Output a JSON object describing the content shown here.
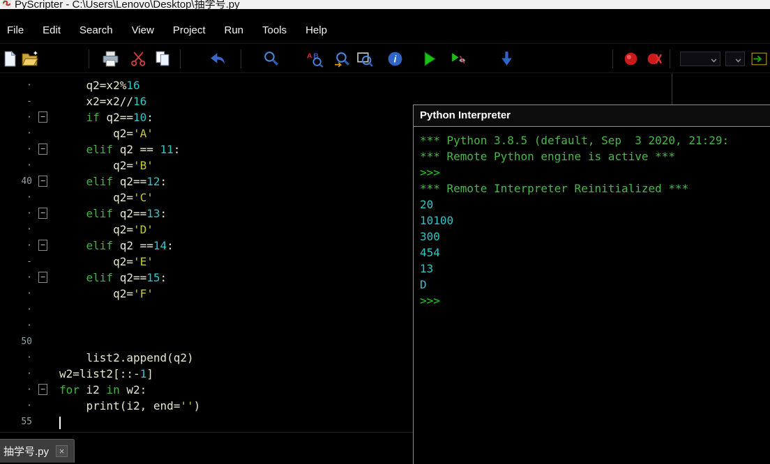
{
  "window": {
    "title": "PyScripter - C:\\Users\\Lenovo\\Desktop\\抽学号.py"
  },
  "menu": {
    "items": [
      "File",
      "Edit",
      "Search",
      "View",
      "Project",
      "Run",
      "Tools",
      "Help"
    ]
  },
  "toolbar": {
    "icon_names": [
      "new-file-icon",
      "open-file-icon",
      "print-icon",
      "cut-icon",
      "copy-icon",
      "undo-icon",
      "search-icon",
      "find-replace-icon",
      "find-next-icon",
      "find-in-files-icon",
      "info-icon",
      "run-icon",
      "debug-icon",
      "step-down-icon",
      "breakpoint-icon",
      "clear-breakpoints-icon",
      "run-config-dropdown",
      "secondary-dropdown",
      "layout-icon"
    ]
  },
  "colors": {
    "keyword": "#3cba3c",
    "number": "#2fc6c6",
    "string": "#c9c938",
    "identifier": "#e7e7cf",
    "interpreter_message": "#49b849",
    "interpreter_prompt": "#12d212",
    "interpreter_output": "#2fc6c6",
    "run_green": "#18c018",
    "stop_red": "#cc1a1a"
  },
  "editor": {
    "visible_line_numbers": [
      "40",
      "50",
      "55"
    ],
    "lines": [
      {
        "gutter": "·",
        "fold": false,
        "tokens": [
          [
            "id",
            "    q2=x2%"
          ],
          [
            "num",
            "16"
          ]
        ]
      },
      {
        "gutter": "-",
        "fold": false,
        "tokens": [
          [
            "id",
            "    x2=x2//"
          ],
          [
            "num",
            "16"
          ]
        ]
      },
      {
        "gutter": "·",
        "fold": true,
        "tokens": [
          [
            "id",
            "    "
          ],
          [
            "kw",
            "if"
          ],
          [
            "id",
            " q2=="
          ],
          [
            "num",
            "10"
          ],
          [
            "id",
            ":"
          ]
        ]
      },
      {
        "gutter": "·",
        "fold": false,
        "tokens": [
          [
            "id",
            "        q2="
          ],
          [
            "str",
            "'A'"
          ]
        ]
      },
      {
        "gutter": "·",
        "fold": true,
        "tokens": [
          [
            "id",
            "    "
          ],
          [
            "kw",
            "elif"
          ],
          [
            "id",
            " q2 == "
          ],
          [
            "num",
            "11"
          ],
          [
            "id",
            ":"
          ]
        ]
      },
      {
        "gutter": "·",
        "fold": false,
        "tokens": [
          [
            "id",
            "        q2="
          ],
          [
            "str",
            "'B'"
          ]
        ]
      },
      {
        "gutter": "40",
        "fold": true,
        "tokens": [
          [
            "id",
            "    "
          ],
          [
            "kw",
            "elif"
          ],
          [
            "id",
            " q2=="
          ],
          [
            "num",
            "12"
          ],
          [
            "id",
            ":"
          ]
        ]
      },
      {
        "gutter": "·",
        "fold": false,
        "tokens": [
          [
            "id",
            "        q2="
          ],
          [
            "str",
            "'C'"
          ]
        ]
      },
      {
        "gutter": "·",
        "fold": true,
        "tokens": [
          [
            "id",
            "    "
          ],
          [
            "kw",
            "elif"
          ],
          [
            "id",
            " q2=="
          ],
          [
            "num",
            "13"
          ],
          [
            "id",
            ":"
          ]
        ]
      },
      {
        "gutter": "·",
        "fold": false,
        "tokens": [
          [
            "id",
            "        q2="
          ],
          [
            "str",
            "'D'"
          ]
        ]
      },
      {
        "gutter": "·",
        "fold": true,
        "tokens": [
          [
            "id",
            "    "
          ],
          [
            "kw",
            "elif"
          ],
          [
            "id",
            " q2 =="
          ],
          [
            "num",
            "14"
          ],
          [
            "id",
            ":"
          ]
        ]
      },
      {
        "gutter": "-",
        "fold": false,
        "tokens": [
          [
            "id",
            "        q2="
          ],
          [
            "str",
            "'E'"
          ]
        ]
      },
      {
        "gutter": "·",
        "fold": true,
        "tokens": [
          [
            "id",
            "    "
          ],
          [
            "kw",
            "elif"
          ],
          [
            "id",
            " q2=="
          ],
          [
            "num",
            "15"
          ],
          [
            "id",
            ":"
          ]
        ]
      },
      {
        "gutter": "·",
        "fold": false,
        "tokens": [
          [
            "id",
            "        q2="
          ],
          [
            "str",
            "'F'"
          ]
        ]
      },
      {
        "gutter": "·",
        "fold": false,
        "tokens": []
      },
      {
        "gutter": "·",
        "fold": false,
        "tokens": []
      },
      {
        "gutter": "50",
        "fold": false,
        "tokens": []
      },
      {
        "gutter": "·",
        "fold": false,
        "tokens": [
          [
            "id",
            "    list2.append(q2)"
          ]
        ]
      },
      {
        "gutter": "·",
        "fold": false,
        "tokens": [
          [
            "id",
            "w2=list2[::-"
          ],
          [
            "num",
            "1"
          ],
          [
            "id",
            "]"
          ]
        ]
      },
      {
        "gutter": "·",
        "fold": true,
        "tokens": [
          [
            "kw",
            "for"
          ],
          [
            "id",
            " i2 "
          ],
          [
            "kw",
            "in"
          ],
          [
            "id",
            " w2:"
          ]
        ]
      },
      {
        "gutter": "·",
        "fold": false,
        "tokens": [
          [
            "id",
            "    print(i2, end="
          ],
          [
            "str",
            "''"
          ],
          [
            "id",
            ")"
          ]
        ]
      },
      {
        "gutter": "55",
        "fold": false,
        "cursor": true,
        "tokens": []
      }
    ]
  },
  "interpreter": {
    "title": "Python Interpreter",
    "lines": [
      {
        "text": "*** Python 3.8.5 (default, Sep  3 2020, 21:29:",
        "color": "msg"
      },
      {
        "text": "*** Remote Python engine is active ***",
        "color": "msg"
      },
      {
        "text": ">>>",
        "color": "prompt"
      },
      {
        "text": "*** Remote Interpreter Reinitialized ***",
        "color": "msg"
      },
      {
        "text": "20",
        "color": "out"
      },
      {
        "text": "10100",
        "color": "out"
      },
      {
        "text": "300",
        "color": "out"
      },
      {
        "text": "454",
        "color": "out"
      },
      {
        "text": "13",
        "color": "out"
      },
      {
        "text": "D",
        "color": "out"
      },
      {
        "text": ">>>",
        "color": "prompt"
      }
    ]
  },
  "tabbar": {
    "active_tab": "抽学号.py",
    "close_glyph": "×"
  }
}
